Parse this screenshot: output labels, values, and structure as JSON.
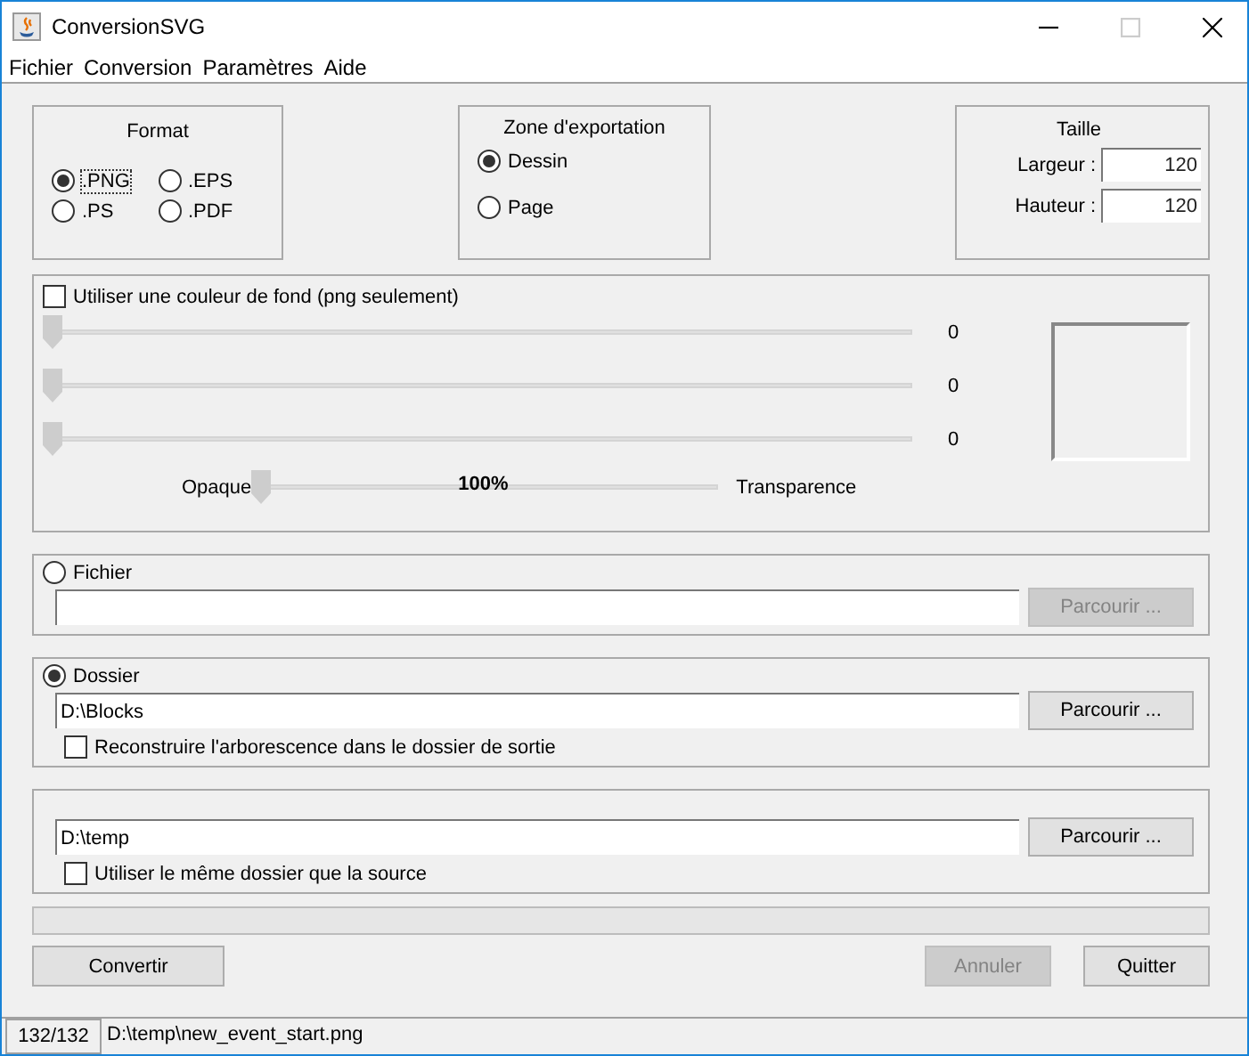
{
  "window": {
    "title": "ConversionSVG"
  },
  "menu": [
    "Fichier",
    "Conversion",
    "Paramètres",
    "Aide"
  ],
  "format": {
    "title": "Format",
    "options": [
      {
        "label": ".PNG",
        "selected": true,
        "focused": true
      },
      {
        "label": ".EPS",
        "selected": false,
        "focused": false
      },
      {
        "label": ".PS",
        "selected": false,
        "focused": false
      },
      {
        "label": ".PDF",
        "selected": false,
        "focused": false
      }
    ]
  },
  "zone": {
    "title": "Zone d'exportation",
    "options": [
      {
        "label": "Dessin",
        "selected": true
      },
      {
        "label": "Page",
        "selected": false
      }
    ]
  },
  "taille": {
    "title": "Taille",
    "fields": [
      {
        "label": "Largeur :",
        "value": "120"
      },
      {
        "label": "Hauteur :",
        "value": "120"
      }
    ]
  },
  "background": {
    "label": "Utiliser une couleur de fond (png seulement)",
    "checked": false,
    "channels": [
      {
        "level": 0,
        "reading": "0"
      },
      {
        "level": 0,
        "reading": "0"
      },
      {
        "level": 0,
        "reading": "0"
      }
    ],
    "opacity": {
      "left": "Opaque",
      "reading": "100%",
      "right": "Transparence",
      "level": 0
    }
  },
  "sources": [
    {
      "label": "Fichier",
      "selected": false,
      "browse": {
        "label": "Parcourir ...",
        "disabled": true
      }
    },
    {
      "label": "Dossier",
      "selected": true,
      "value": "D:\\Blocks",
      "browse": {
        "label": "Parcourir ...",
        "disabled": false
      },
      "option": {
        "label": "Reconstruire l'arborescence dans le dossier de sortie",
        "checked": false
      }
    }
  ],
  "output": {
    "value": "D:\\temp",
    "browse": {
      "label": "Parcourir ...",
      "disabled": false
    },
    "option": {
      "label": "Utiliser le même dossier que la source",
      "checked": false
    }
  },
  "progress": {
    "level": 0
  },
  "buttons": [
    {
      "label": "Convertir",
      "disabled": false
    },
    {
      "label": "Annuler",
      "disabled": true
    },
    {
      "label": "Quitter",
      "disabled": false
    }
  ],
  "status_bar": {
    "count": "132/132",
    "path": "D:\\temp\\new_event_start.png"
  }
}
